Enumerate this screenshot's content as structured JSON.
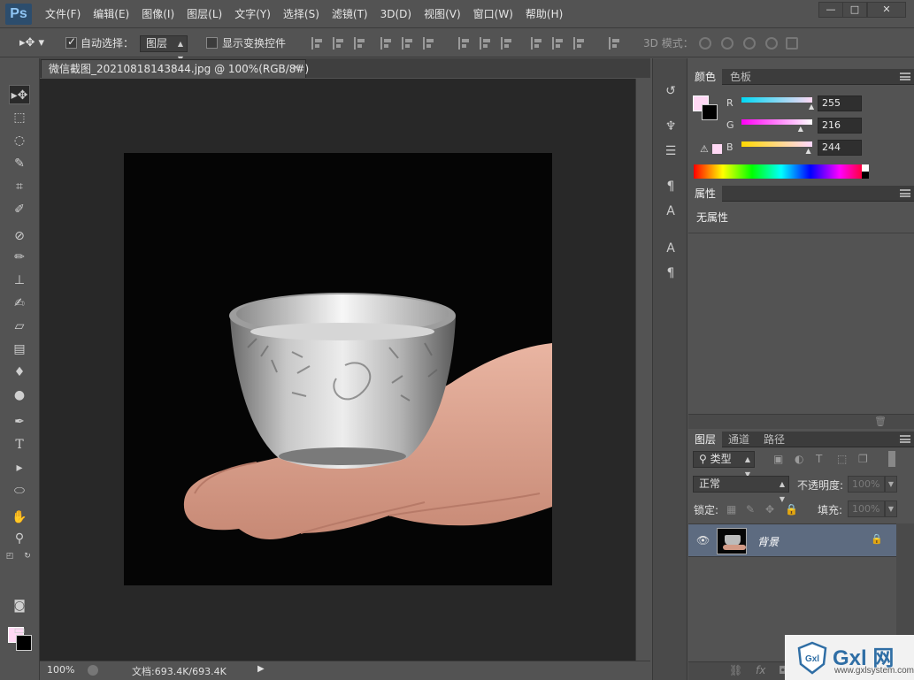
{
  "app": {
    "logo": "Ps"
  },
  "menu": [
    "文件(F)",
    "编辑(E)",
    "图像(I)",
    "图层(L)",
    "文字(Y)",
    "选择(S)",
    "滤镜(T)",
    "3D(D)",
    "视图(V)",
    "窗口(W)",
    "帮助(H)"
  ],
  "window_controls": {
    "minimize": "—",
    "maximize": "□",
    "close": "✕"
  },
  "options": {
    "auto_select_label": "自动选择：",
    "auto_select_checked": true,
    "auto_select_target": "图层",
    "show_transform_label": "显示变换控件",
    "mode_3d_label": "3D 模式："
  },
  "document": {
    "tab_title": "微信截图_20210818143844.jpg @ 100%(RGB/8#)",
    "zoom": "100%",
    "doc_info": "文档:693.4K/693.4K"
  },
  "color_panel": {
    "tabs": [
      "颜色",
      "色板"
    ],
    "channels": [
      {
        "name": "R",
        "value": "255",
        "level": 1.0
      },
      {
        "name": "G",
        "value": "216",
        "level": 0.847
      },
      {
        "name": "B",
        "value": "244",
        "level": 0.957
      }
    ],
    "foreground_color": "#ffd8f4",
    "background_color": "#000000"
  },
  "properties_panel": {
    "tab": "属性",
    "content": "无属性"
  },
  "layers_panel": {
    "tabs": [
      "图层",
      "通道",
      "路径"
    ],
    "filter_type": "类型",
    "blend_mode": "正常",
    "opacity_label": "不透明度:",
    "opacity_value": "100%",
    "lock_label": "锁定:",
    "fill_label": "填充:",
    "fill_value": "100%",
    "layers": [
      {
        "name": "背景",
        "visible": true,
        "locked": true
      }
    ]
  },
  "watermark": {
    "brand": "Gxl 网",
    "url": "www.gxlsystem.com"
  }
}
